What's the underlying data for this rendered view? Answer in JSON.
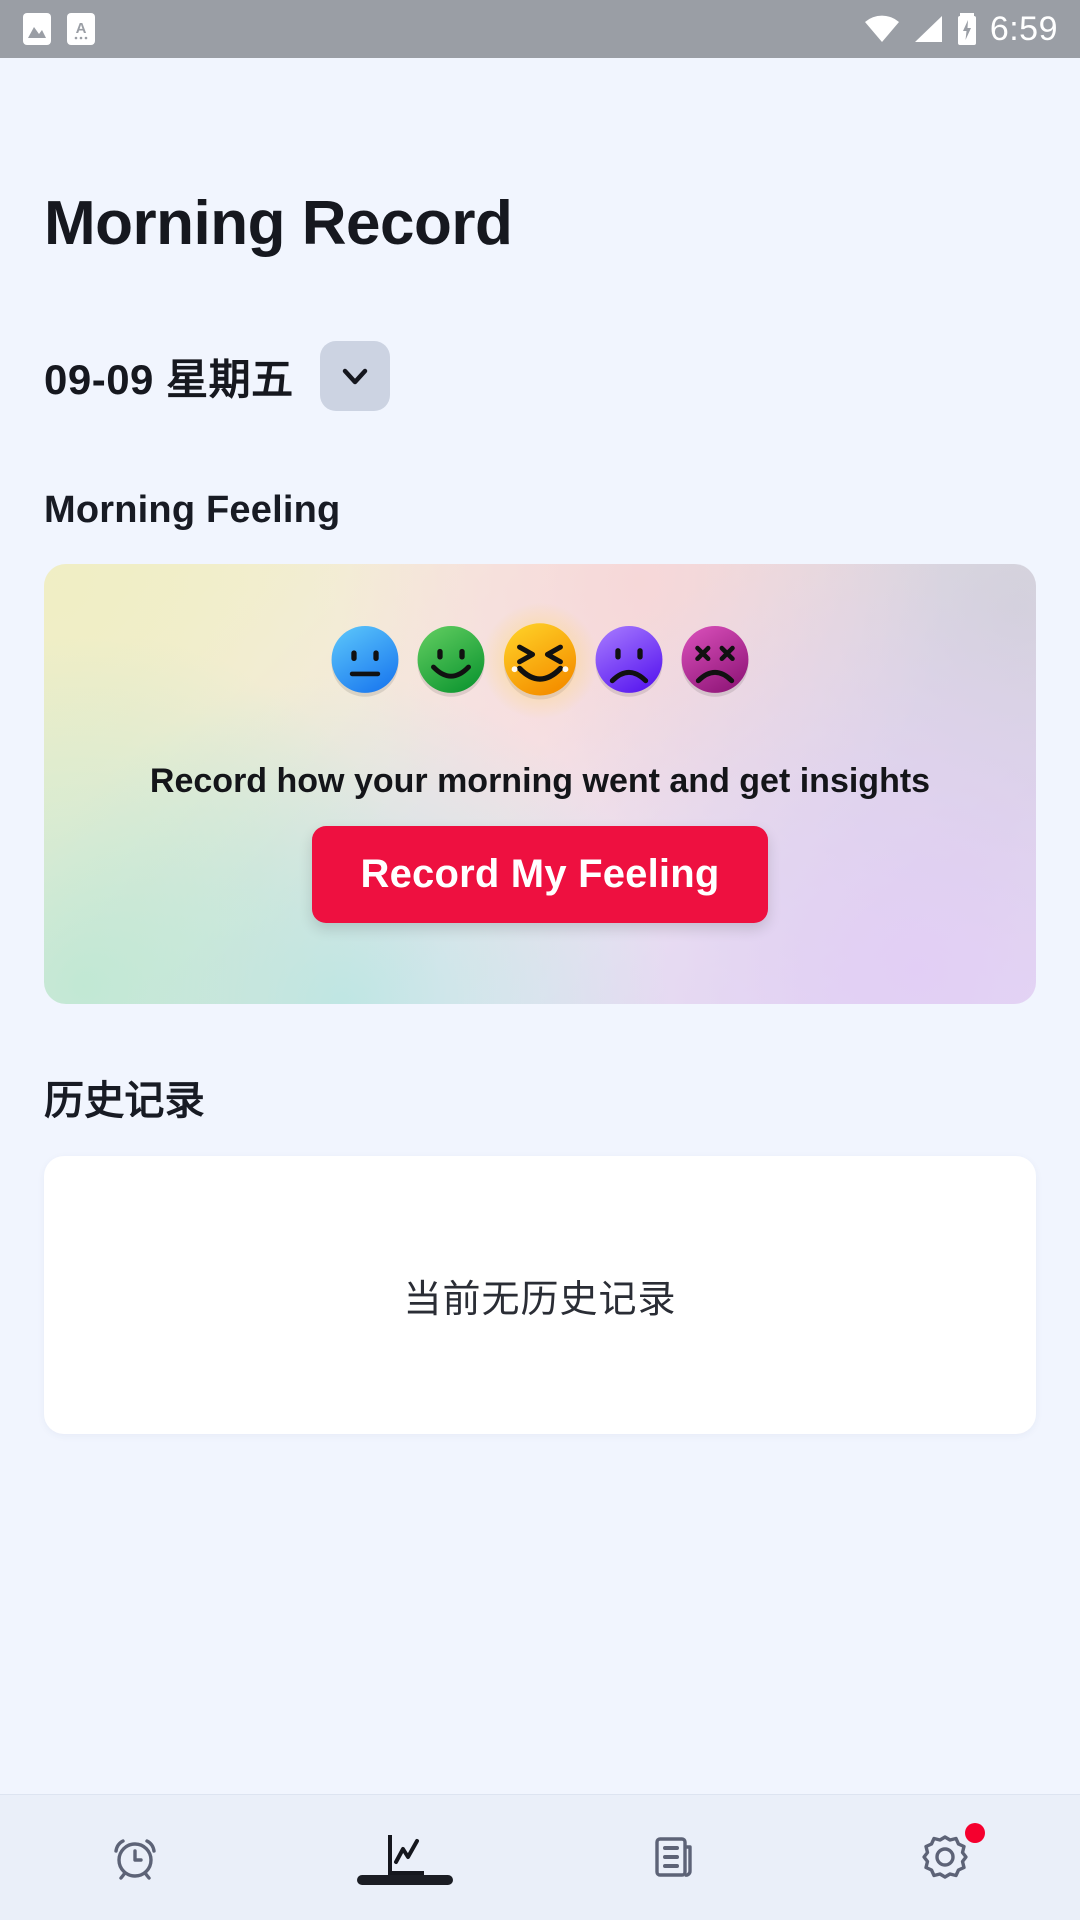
{
  "statusbar": {
    "time": "6:59",
    "left_icons": [
      "image-icon",
      "screenshot-a-icon"
    ],
    "right_icons": [
      "wifi-icon",
      "cellular-signal-icon",
      "battery-charging-icon"
    ]
  },
  "header": {
    "title": "Morning Record"
  },
  "date_selector": {
    "label": "09-09 星期五",
    "chevron": "chevron-down-icon"
  },
  "feeling_section": {
    "title": "Morning Feeling",
    "caption": "Record how your morning went and get insights",
    "cta_label": "Record My Feeling",
    "cta_color": "#ee1040",
    "emojis": [
      {
        "name": "neutral-face",
        "color": "#2f9bf5",
        "color2": "#58c8fb",
        "eyes": "dots",
        "mouth": "flat",
        "selected": false
      },
      {
        "name": "smiling-face",
        "color": "#22a13f",
        "color2": "#55c95e",
        "eyes": "dots",
        "mouth": "smile",
        "selected": false
      },
      {
        "name": "laughing-face",
        "color": "#f9a400",
        "color2": "#ffd024",
        "eyes": "squint",
        "mouth": "big-smile",
        "selected": true
      },
      {
        "name": "sad-face",
        "color": "#6e2df0",
        "color2": "#9e7bff",
        "eyes": "dots",
        "mouth": "frown",
        "selected": false
      },
      {
        "name": "dead-face",
        "color": "#a2208c",
        "color2": "#d749b6",
        "eyes": "x",
        "mouth": "frown",
        "selected": false
      }
    ]
  },
  "history_section": {
    "title": "历史记录",
    "empty_text": "当前无历史记录"
  },
  "bottom_nav": {
    "items": [
      {
        "name": "alarm",
        "icon": "alarm-clock-icon",
        "active": false,
        "badge": false
      },
      {
        "name": "chart",
        "icon": "line-chart-icon",
        "active": true,
        "badge": false
      },
      {
        "name": "articles",
        "icon": "newspaper-icon",
        "active": false,
        "badge": false
      },
      {
        "name": "settings",
        "icon": "gear-icon",
        "active": false,
        "badge": true
      }
    ]
  },
  "colors": {
    "background": "#f1f5fe",
    "nav_background": "#eaeff9",
    "accent_red": "#ee1040",
    "badge_red": "#f5002e",
    "icon_gray": "#5d6377",
    "icon_active": "#15171e",
    "text_dark": "#16181f"
  }
}
